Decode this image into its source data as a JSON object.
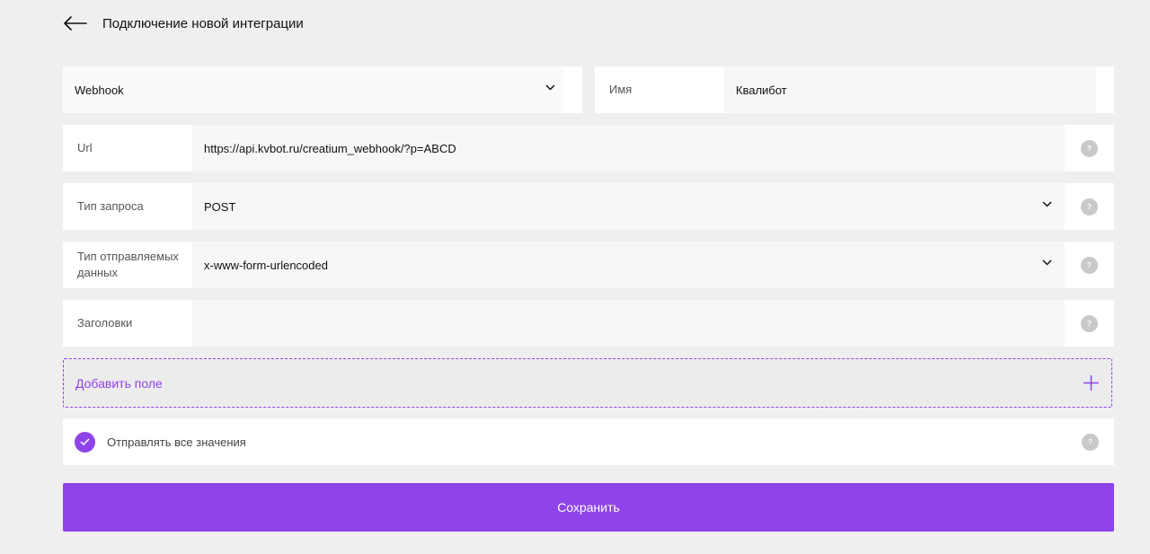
{
  "header": {
    "title": "Подключение новой интеграции"
  },
  "integration_type": {
    "value": "Webhook"
  },
  "name_field": {
    "label": "Имя",
    "value": "Квалибот"
  },
  "fields": [
    {
      "label": "Url",
      "value": "https://api.kvbot.ru/creatium_webhook/?p=ABCD"
    },
    {
      "label": "Тип запроса",
      "value": "POST"
    },
    {
      "label": "Тип отправляемых данных",
      "value": "x-www-form-urlencoded"
    },
    {
      "label": "Заголовки",
      "value": ""
    }
  ],
  "help_icon_text": "?",
  "add_field": {
    "label": "Добавить поле"
  },
  "send_all": {
    "label": "Отправлять все значения",
    "checked": true
  },
  "save_button": {
    "label": "Сохранить"
  },
  "colors": {
    "accent": "#8e44e8",
    "background": "#efefef",
    "help_icon": "#c9c9c9"
  },
  "icons": {
    "back": "arrow-left-icon",
    "dropdown": "chevron-down-icon",
    "help": "question-icon",
    "add": "plus-icon",
    "check": "check-icon"
  }
}
